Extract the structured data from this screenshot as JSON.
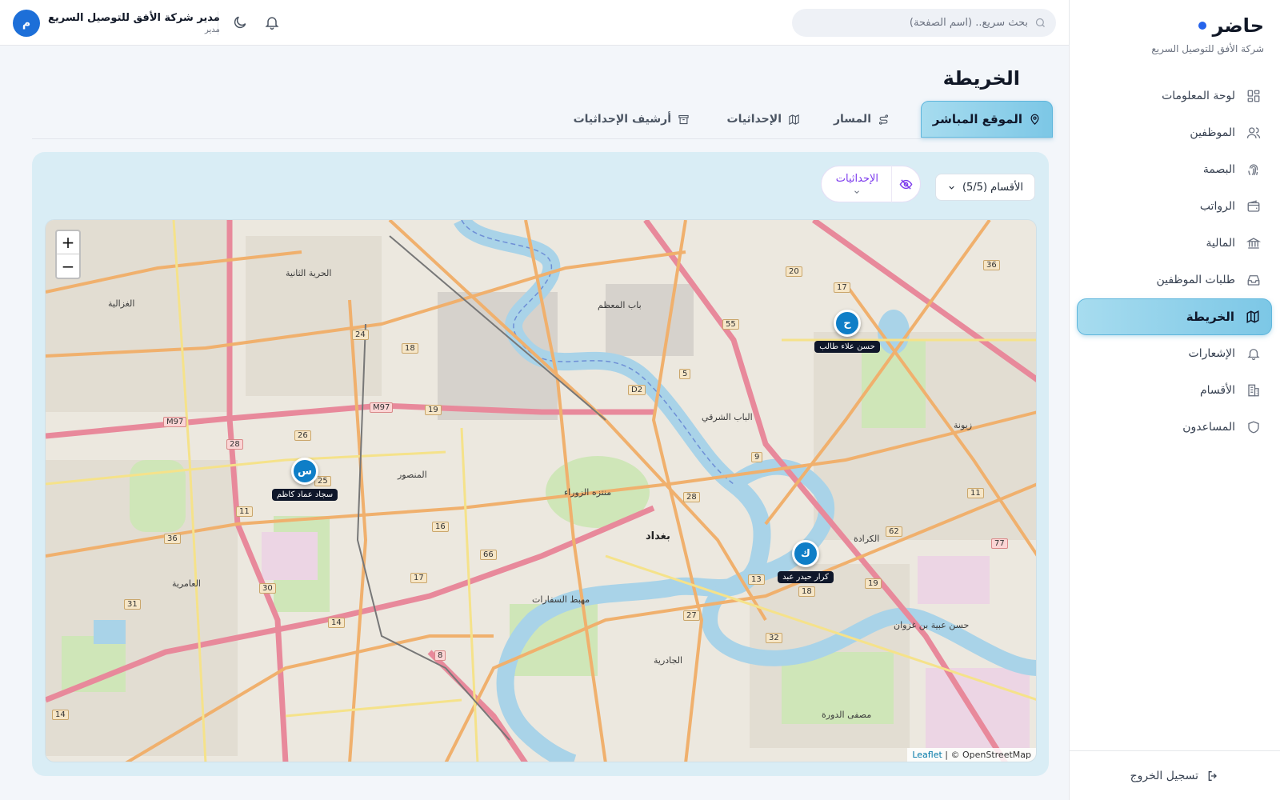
{
  "brand": {
    "title": "حاضر",
    "subtitle": "شركة الأفق للتوصيل السريع"
  },
  "sidebar": {
    "items": [
      {
        "label": "لوحة المعلومات",
        "icon": "dashboard-icon",
        "active": false
      },
      {
        "label": "الموظفين",
        "icon": "users-icon",
        "active": false
      },
      {
        "label": "البصمة",
        "icon": "fingerprint-icon",
        "active": false
      },
      {
        "label": "الرواتب",
        "icon": "wallet-icon",
        "active": false
      },
      {
        "label": "المالية",
        "icon": "bank-icon",
        "active": false
      },
      {
        "label": "طلبات الموظفين",
        "icon": "inbox-icon",
        "active": false
      },
      {
        "label": "الخريطة",
        "icon": "map-icon",
        "active": true
      },
      {
        "label": "الإشعارات",
        "icon": "bell-icon",
        "active": false
      },
      {
        "label": "الأقسام",
        "icon": "building-icon",
        "active": false
      },
      {
        "label": "المساعدون",
        "icon": "shield-icon",
        "active": false
      }
    ],
    "logout_label": "تسجيل الخروج"
  },
  "topbar": {
    "search_placeholder": "بحث سريع.. (اسم الصفحة)",
    "user_name": "مدير شركة الأفق للتوصيل السريع",
    "user_role": "مدير",
    "avatar_initial": "م"
  },
  "page": {
    "title": "الخريطة",
    "tabs": [
      {
        "label": "الموقع المباشر",
        "icon": "map-pin-icon",
        "active": true
      },
      {
        "label": "المسار",
        "icon": "route-icon",
        "active": false
      },
      {
        "label": "الإحداثيات",
        "icon": "map-icon",
        "active": false
      },
      {
        "label": "أرشيف الإحداثيات",
        "icon": "archive-icon",
        "active": false
      }
    ]
  },
  "controls": {
    "sections_label": "الأقسام (5/5)",
    "coords_label": "الإحداثيات"
  },
  "map": {
    "zoom_in": "+",
    "zoom_out": "−",
    "attribution_link": "Leaflet",
    "attribution_text": " | © OpenStreetMap",
    "markers": [
      {
        "initial": "ح",
        "name": "حسن علاء طالب"
      },
      {
        "initial": "س",
        "name": "سجاد عماد كاظم"
      },
      {
        "initial": "ك",
        "name": "كرار حيدر عبد"
      }
    ],
    "places": [
      "باب المعظم",
      "الباب الشرقي",
      "المنصور",
      "بغداد",
      "الكرادة",
      "زيونة",
      "الغزالية",
      "العامرية",
      "الجادرية",
      "الحرية الثانية",
      "منتزه الزوراء",
      "مصفى الدورة",
      "حسن عبية بن غزوان",
      "مهبط السفارات"
    ],
    "road_numbers": [
      "24",
      "18",
      "M97",
      "19",
      "M97",
      "28",
      "26",
      "11",
      "36",
      "30",
      "14",
      "31",
      "8",
      "17",
      "66",
      "16",
      "55",
      "5",
      "D2",
      "20",
      "17",
      "36",
      "9",
      "28",
      "13",
      "18",
      "27",
      "32",
      "19",
      "62",
      "11",
      "77",
      "14",
      "25"
    ]
  },
  "colors": {
    "accent": "#7cc7e6",
    "marker": "#0f7ec7",
    "brand_dot": "#2563eb",
    "purple": "#7c3aed"
  }
}
